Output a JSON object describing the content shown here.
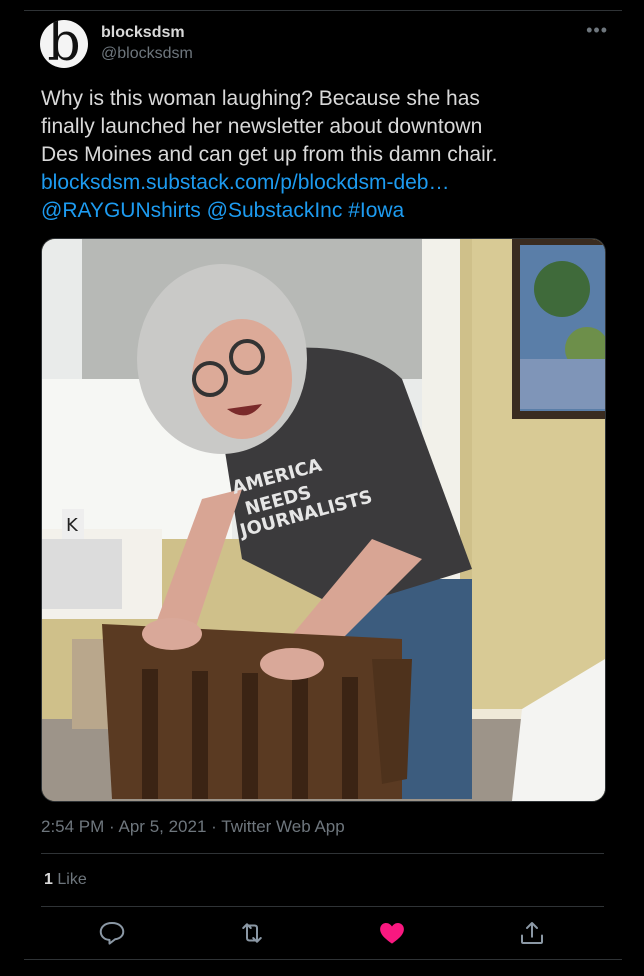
{
  "author": {
    "display_name": "blocksdsm",
    "handle": "@blocksdsm",
    "avatar_letter": "b"
  },
  "tweet": {
    "line1": "Why is this woman laughing? Because she has",
    "line2": "finally launched her newsletter about downtown",
    "line3": "Des Moines and can get up from this damn chair.",
    "link": "blocksdsm.substack.com/p/blockdsm-deb…",
    "mention1": "@RAYGUNshirts",
    "mention2": "@SubstackInc",
    "hashtag": "#Iowa"
  },
  "photo": {
    "shirt_line1": "AMERICA",
    "shirt_line2": "NEEDS",
    "shirt_line3": "JOURNALISTS",
    "mug_letter": "K"
  },
  "meta": {
    "time": "2:54 PM",
    "sep1": "·",
    "date": "Apr 5, 2021",
    "sep2": "·",
    "app": "Twitter Web App"
  },
  "stats": {
    "like_count": "1",
    "like_label": "Like"
  },
  "colors": {
    "background": "#000000",
    "link": "#1d9bf0",
    "secondary_text": "#6e767d",
    "like_active": "#f91880",
    "divider": "#2f3336"
  },
  "icons": {
    "more": "more-horizontal-icon",
    "reply": "reply-icon",
    "retweet": "retweet-icon",
    "like": "heart-filled-icon",
    "share": "share-icon"
  }
}
